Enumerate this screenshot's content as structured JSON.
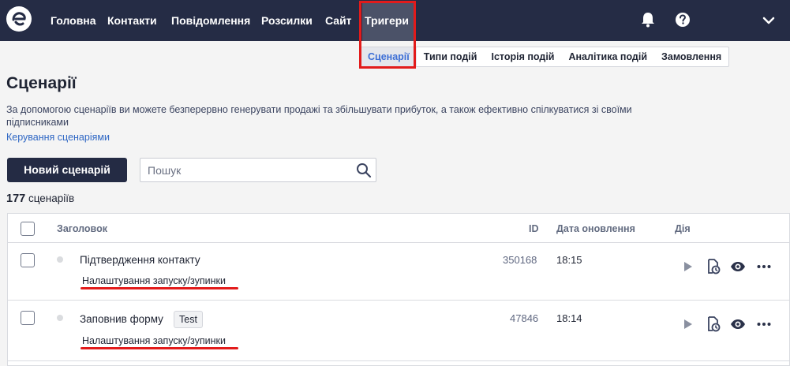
{
  "topbar": {
    "nav": [
      {
        "label": "Головна"
      },
      {
        "label": "Контакти"
      },
      {
        "label": "Повідомлення"
      },
      {
        "label": "Розсилки"
      },
      {
        "label": "Сайт"
      },
      {
        "label": "Тригери",
        "active": true
      }
    ]
  },
  "submenu": {
    "items": [
      {
        "label": "Сценарії",
        "active": true
      },
      {
        "label": "Типи подій"
      },
      {
        "label": "Історія подій"
      },
      {
        "label": "Аналітика подій"
      },
      {
        "label": "Замовлення"
      }
    ]
  },
  "page": {
    "title": "Сценарії",
    "description": "За допомогою сценаріїв ви можете безперервно генерувати продажі та збільшувати прибуток, а також ефективно спілкуватися зі своїми підписниками",
    "manage_link": "Керування сценаріями",
    "new_button": "Новий сценарій",
    "search_placeholder": "Пошук",
    "count_number": "177",
    "count_label": "сценаріїв"
  },
  "table": {
    "headers": {
      "title": "Заголовок",
      "id": "ID",
      "date": "Дата оновлення",
      "action": "Дія"
    },
    "rows": [
      {
        "title": "Підтвердження контакту",
        "tag": "",
        "id": "350168",
        "date": "18:15",
        "sublink": "Налаштування запуску/зупинки"
      },
      {
        "title": "Заповнив форму",
        "tag": "Test",
        "id": "47846",
        "date": "18:14",
        "sublink": "Налаштування запуску/зупинки"
      }
    ]
  },
  "colors": {
    "topbar": "#252c45",
    "accent_link": "#2f67c4",
    "highlight": "#e21b1b"
  }
}
